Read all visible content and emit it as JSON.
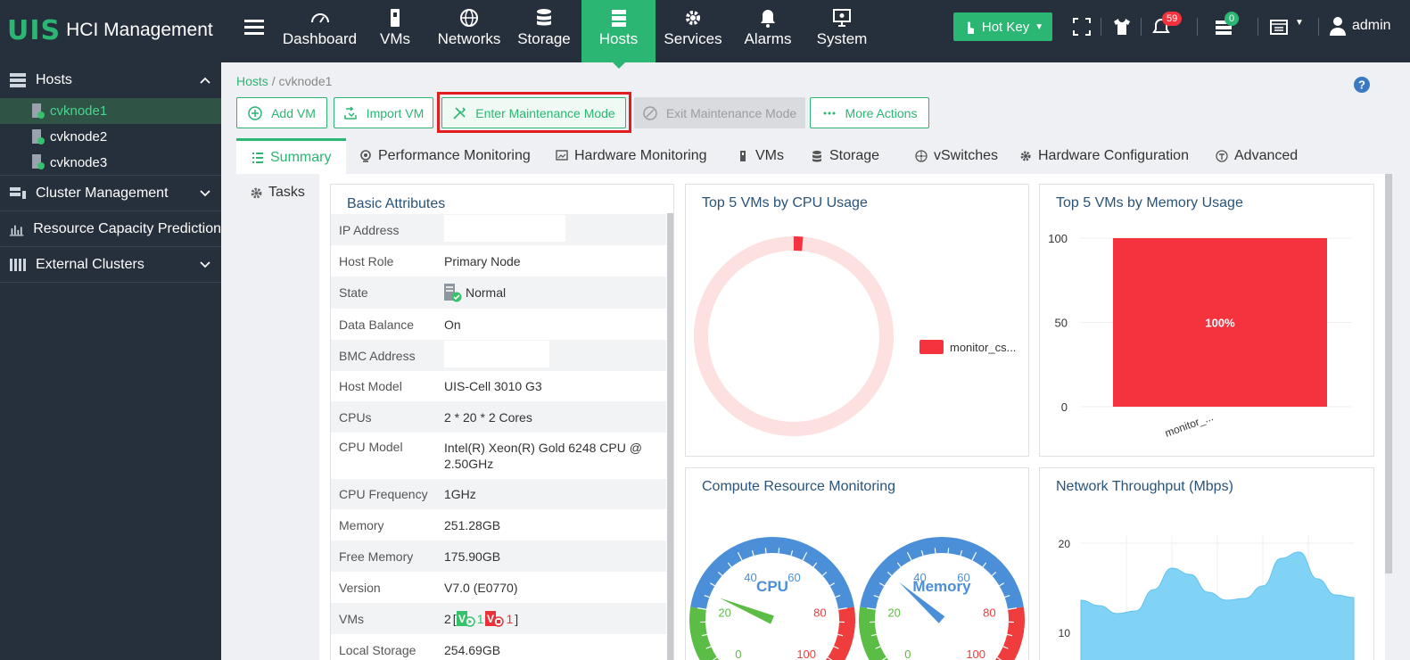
{
  "brand": {
    "logo": "UIS",
    "product": "HCI Management"
  },
  "nav": [
    {
      "label": "Dashboard",
      "icon": "gauge-icon"
    },
    {
      "label": "VMs",
      "icon": "vm-icon"
    },
    {
      "label": "Networks",
      "icon": "globe-icon"
    },
    {
      "label": "Storage",
      "icon": "database-icon"
    },
    {
      "label": "Hosts",
      "icon": "server-icon",
      "active": true
    },
    {
      "label": "Services",
      "icon": "gear-icon"
    },
    {
      "label": "Alarms",
      "icon": "alarm-bell-icon"
    },
    {
      "label": "System",
      "icon": "monitor-gear-icon"
    }
  ],
  "toolbar": {
    "hotkey_label": "Hot Key",
    "alarm_count": "59",
    "task_count": "0",
    "user": "admin"
  },
  "sidebar": {
    "hosts_label": "Hosts",
    "hosts": [
      "cvknode1",
      "cvknode2",
      "cvknode3"
    ],
    "sections": [
      "Cluster Management",
      "Resource Capacity Prediction",
      "External Clusters"
    ]
  },
  "breadcrumb": {
    "root": "Hosts",
    "current": "cvknode1"
  },
  "actions": {
    "add_vm": "Add VM",
    "import_vm": "Import VM",
    "enter_maintenance": "Enter Maintenance Mode",
    "exit_maintenance": "Exit Maintenance Mode",
    "more_actions": "More Actions"
  },
  "tabs": [
    "Summary",
    "Performance Monitoring",
    "Hardware Monitoring",
    "VMs",
    "Storage",
    "vSwitches",
    "Hardware Configuration",
    "Advanced"
  ],
  "side_tab": "Tasks",
  "basic": {
    "title": "Basic Attributes",
    "rows": [
      {
        "k": "IP Address",
        "v": ""
      },
      {
        "k": "Host Role",
        "v": "Primary Node"
      },
      {
        "k": "State",
        "v": "Normal"
      },
      {
        "k": "Data Balance",
        "v": "On"
      },
      {
        "k": "BMC Address",
        "v": ""
      },
      {
        "k": "Host Model",
        "v": "UIS-Cell 3010 G3"
      },
      {
        "k": "CPUs",
        "v": "2 * 20 * 2 Cores"
      },
      {
        "k": "CPU Model",
        "v": "Intel(R) Xeon(R) Gold 6248 CPU @ 2.50GHz"
      },
      {
        "k": "CPU Frequency",
        "v": "1GHz"
      },
      {
        "k": "Memory",
        "v": "251.28GB"
      },
      {
        "k": "Free Memory",
        "v": "175.90GB"
      },
      {
        "k": "Version",
        "v": "V7.0 (E0770)"
      },
      {
        "k": "VMs",
        "v": "2"
      },
      {
        "k": "Local Storage",
        "v": "254.69GB"
      }
    ],
    "vm_running": "1",
    "vm_stopped": "1"
  },
  "cpu_panel": {
    "title": "Top 5 VMs by CPU Usage",
    "legend": "monitor_cs..."
  },
  "mem_panel": {
    "title": "Top 5 VMs by Memory Usage",
    "bar_label": "100%",
    "x_label": "monitor_..."
  },
  "compute_panel": {
    "title": "Compute Resource Monitoring",
    "cpu_label": "CPU",
    "mem_label": "Memory"
  },
  "net_panel": {
    "title": "Network Throughput (Mbps)"
  },
  "chart_data": [
    {
      "type": "pie",
      "title": "Top 5 VMs by CPU Usage",
      "categories": [
        "monitor_cs..."
      ],
      "values": [
        1.5
      ],
      "colors": [
        "#f5333f"
      ],
      "legend": "right"
    },
    {
      "type": "bar",
      "title": "Top 5 VMs by Memory Usage",
      "categories": [
        "monitor_..."
      ],
      "values": [
        100
      ],
      "ylim": [
        0,
        100
      ],
      "yticks": [
        0,
        50,
        100
      ],
      "data_labels": [
        "100%"
      ],
      "colors": [
        "#f5333f"
      ]
    },
    {
      "type": "gauge",
      "title": "CPU",
      "ticks": [
        0,
        20,
        40,
        60,
        80,
        100
      ],
      "value": 25
    },
    {
      "type": "gauge",
      "title": "Memory",
      "ticks": [
        0,
        20,
        40,
        60,
        80,
        100
      ],
      "value": 32
    },
    {
      "type": "area",
      "title": "Network Throughput (Mbps)",
      "yticks": [
        10,
        20
      ],
      "ylim": [
        0,
        20
      ],
      "values": [
        13.6,
        13.0,
        12.1,
        12.4,
        14.8,
        17.2,
        16.5,
        14.5,
        13.6,
        13.8,
        15.2,
        18.3,
        19.0,
        16.0,
        14.2,
        13.9
      ],
      "colors": [
        "#80d3f4"
      ]
    }
  ]
}
